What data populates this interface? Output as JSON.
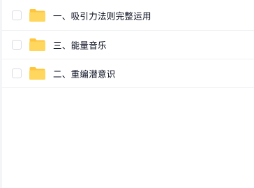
{
  "file_list": {
    "items": [
      {
        "name": "一、吸引力法则完整运用",
        "icon": "folder-icon",
        "checked": false
      },
      {
        "name": "三、能量音乐",
        "icon": "folder-icon",
        "checked": false
      },
      {
        "name": "二、重编潜意识",
        "icon": "folder-icon",
        "checked": false
      }
    ]
  },
  "colors": {
    "folder_body": "#ffd75e",
    "folder_tab": "#ffc53d",
    "text": "#03081a",
    "divider": "#f0f1f3",
    "checkbox_border": "#d9dce1"
  }
}
